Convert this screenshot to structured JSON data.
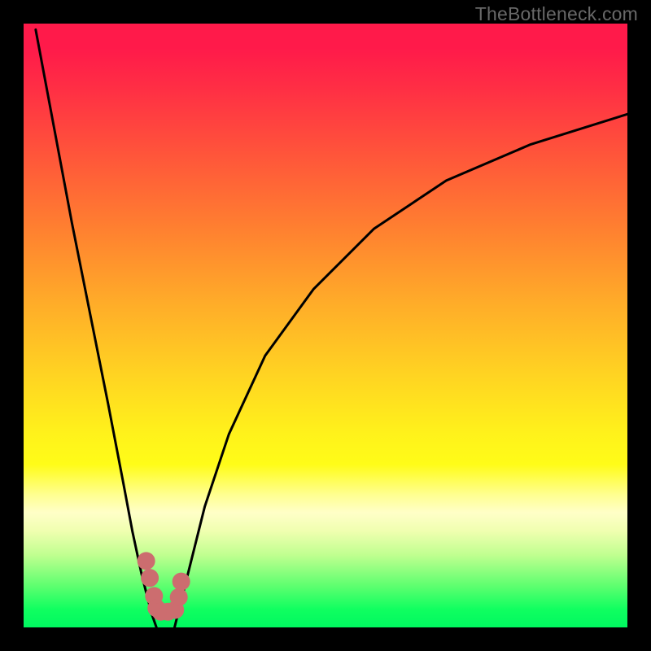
{
  "watermark": "TheBottleneck.com",
  "chart_data": {
    "type": "line",
    "title": "",
    "xlabel": "",
    "ylabel": "",
    "xlim": [
      0,
      100
    ],
    "ylim": [
      0,
      100
    ],
    "axes_hidden": true,
    "legend": false,
    "gradient_background": {
      "top_color": "#ff1a4a",
      "mid_color": "#ffd322",
      "bottom_color": "#00f860",
      "orientation": "vertical"
    },
    "series": [
      {
        "name": "left-curve",
        "stroke": "#000000",
        "x": [
          2,
          5,
          8,
          11,
          14,
          16.5,
          18,
          19.5,
          20.5,
          21.3,
          22
        ],
        "y": [
          99,
          83,
          67,
          52,
          37,
          24,
          16,
          9,
          5,
          2,
          0
        ]
      },
      {
        "name": "right-curve",
        "stroke": "#000000",
        "x": [
          25,
          26,
          27.5,
          30,
          34,
          40,
          48,
          58,
          70,
          84,
          100
        ],
        "y": [
          0,
          4,
          10,
          20,
          32,
          45,
          56,
          66,
          74,
          80,
          85
        ]
      }
    ],
    "markers": [
      {
        "x": 20.3,
        "y": 11.0
      },
      {
        "x": 20.9,
        "y": 8.2
      },
      {
        "x": 21.6,
        "y": 5.2
      },
      {
        "x": 22.0,
        "y": 3.2
      },
      {
        "x": 22.7,
        "y": 2.6
      },
      {
        "x": 23.9,
        "y": 2.6
      },
      {
        "x": 25.1,
        "y": 2.9
      },
      {
        "x": 25.7,
        "y": 5.0
      },
      {
        "x": 26.1,
        "y": 7.6
      }
    ],
    "marker_color": "#cc6d6f",
    "marker_radius_px": 11
  }
}
